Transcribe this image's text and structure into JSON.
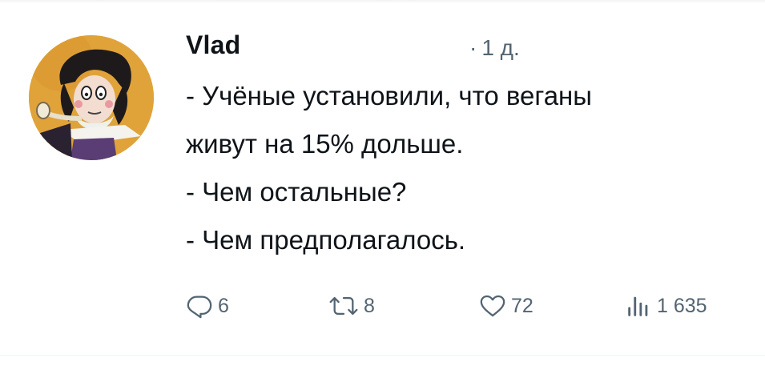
{
  "post": {
    "author": "Vlad",
    "time_separator": "·",
    "time": "1 д.",
    "text_lines": [
      "- Учёные установили, что веганы",
      "живут на 15% дольше.",
      "- Чем остальные?",
      "- Чем предполагалось."
    ],
    "actions": {
      "reply_count": "6",
      "repost_count": "8",
      "like_count": "72",
      "views_count": "1 635"
    }
  },
  "icons": {
    "reply": "reply-icon",
    "repost": "repost-icon",
    "like": "heart-icon",
    "views": "views-icon"
  },
  "colors": {
    "text": "#0f1419",
    "muted": "#536471",
    "background": "#ffffff"
  }
}
